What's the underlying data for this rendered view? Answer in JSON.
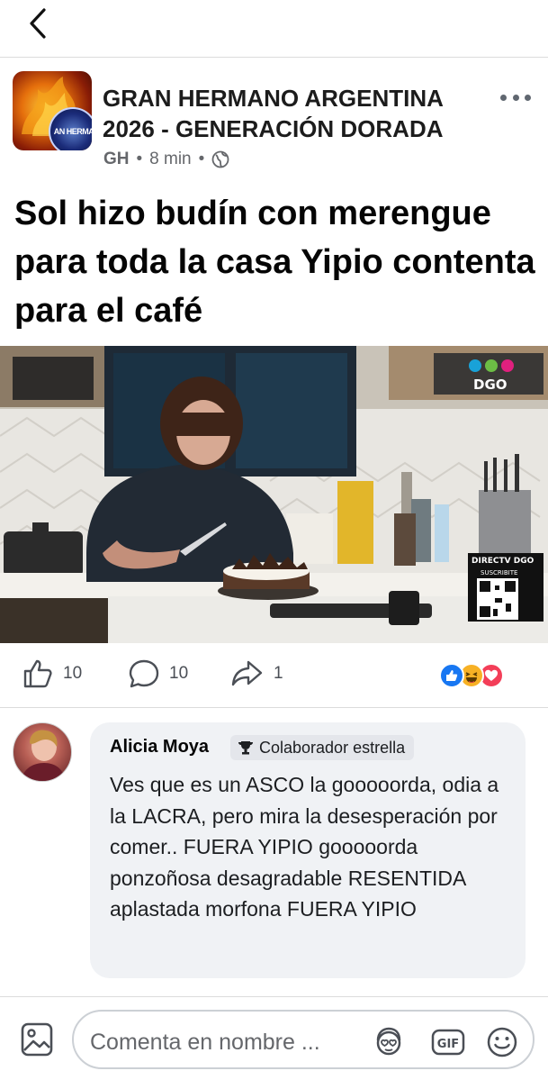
{
  "page": {
    "name": "GRAN HERMANO ARGENTINA 2026 - GENERACIÓN DORADA",
    "avatar_text": "AN HERMA"
  },
  "post": {
    "abbr": "GH",
    "time": "8 min",
    "visibility_icon": "globe-icon",
    "title": "Sol hizo budín con merengue para toda la casa Yipio contenta para el café",
    "media": {
      "channel_logo": "DGO",
      "qr_brand": "DIRECTV DGO",
      "qr_label": "SUSCRIBITE"
    }
  },
  "actions": {
    "likes": "10",
    "comments": "10",
    "shares": "1",
    "reactions": [
      "like-reaction-icon",
      "haha-reaction-icon",
      "love-reaction-icon"
    ]
  },
  "comment": {
    "author": "Alicia Moya",
    "badge": "Colaborador estrella",
    "text": "Ves que es un ASCO la gooooorda, odia a la LACRA, pero mira la desesperación por comer.. FUERA YIPIO gooooorda ponzoñosa desagradable RESENTIDA aplastada morfona FUERA YIPIO"
  },
  "composer": {
    "placeholder": "Comenta en nombre ...",
    "gif_label": "GIF"
  },
  "colors": {
    "accent": "#1877f2",
    "love": "#f33e58",
    "haha": "#f7b125"
  }
}
